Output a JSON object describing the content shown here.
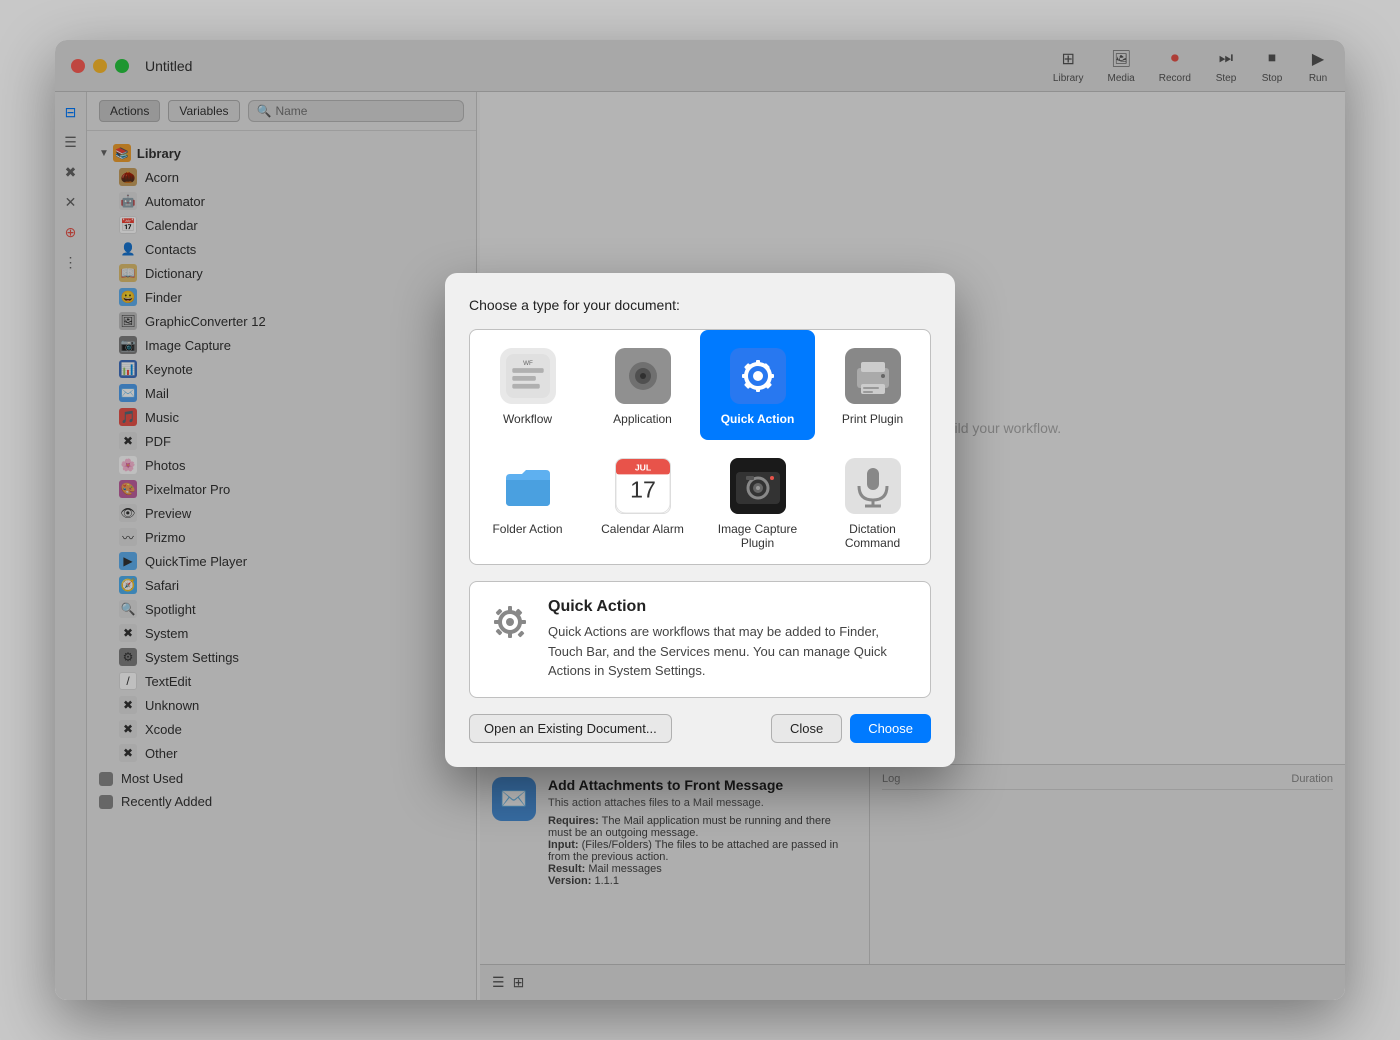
{
  "window": {
    "title": "Untitled",
    "toolbar": {
      "library_label": "Library",
      "media_label": "Media",
      "record_label": "Record",
      "step_label": "Step",
      "stop_label": "Stop",
      "run_label": "Run"
    }
  },
  "sidebar": {
    "tabs": {
      "actions": "Actions",
      "variables": "Variables"
    },
    "search_placeholder": "Name",
    "library_section": "Library",
    "items": [
      {
        "label": "Acorn",
        "icon": "🌰"
      },
      {
        "label": "Automator",
        "icon": "🤖"
      },
      {
        "label": "Calendar",
        "icon": "📅"
      },
      {
        "label": "Contacts",
        "icon": "👤"
      },
      {
        "label": "Dictionary",
        "icon": "📖"
      },
      {
        "label": "Finder",
        "icon": "😀"
      },
      {
        "label": "GraphicConverter 12",
        "icon": "🖼"
      },
      {
        "label": "Image Capture",
        "icon": "📷"
      },
      {
        "label": "Keynote",
        "icon": "📊"
      },
      {
        "label": "Mail",
        "icon": "✉️"
      },
      {
        "label": "Music",
        "icon": "🎵"
      },
      {
        "label": "PDF",
        "icon": "✖"
      },
      {
        "label": "Photos",
        "icon": "🌸"
      },
      {
        "label": "Pixelmator Pro",
        "icon": "🎨"
      },
      {
        "label": "Preview",
        "icon": "👁"
      },
      {
        "label": "Prizmo",
        "icon": "〰"
      },
      {
        "label": "QuickTime Player",
        "icon": "▶"
      },
      {
        "label": "Safari",
        "icon": "🧭"
      },
      {
        "label": "Spotlight",
        "icon": "🔍"
      },
      {
        "label": "System",
        "icon": "✖"
      },
      {
        "label": "System Settings",
        "icon": "⚙"
      },
      {
        "label": "TextEdit",
        "icon": "/"
      },
      {
        "label": "Unknown",
        "icon": "✖"
      },
      {
        "label": "Xcode",
        "icon": "✖"
      },
      {
        "label": "Other",
        "icon": "✖"
      }
    ],
    "categories": [
      {
        "label": "Most Used",
        "color": "#888888"
      },
      {
        "label": "Recently Added",
        "color": "#888888"
      }
    ]
  },
  "bottom_info": {
    "title": "Add Attachments to Front Message",
    "description": "This action attaches files to a Mail message.",
    "requires": "The Mail application must be running and there must be an outgoing message.",
    "input": "(Files/Folders) The files to be attached are passed in from the previous action.",
    "result": "Mail messages",
    "version": "1.1.1"
  },
  "log": {
    "label": "Log",
    "duration_label": "Duration"
  },
  "dialog": {
    "title": "Choose a type for your document:",
    "doc_types": [
      {
        "id": "workflow",
        "label": "Workflow"
      },
      {
        "id": "application",
        "label": "Application"
      },
      {
        "id": "quick_action",
        "label": "Quick Action",
        "selected": true
      },
      {
        "id": "print_plugin",
        "label": "Print Plugin"
      },
      {
        "id": "folder_action",
        "label": "Folder Action"
      },
      {
        "id": "calendar_alarm",
        "label": "Calendar Alarm"
      },
      {
        "id": "image_capture_plugin",
        "label": "Image Capture Plugin"
      },
      {
        "id": "dictation_command",
        "label": "Dictation Command"
      }
    ],
    "selected_title": "Quick Action",
    "selected_description": "Quick Actions are workflows that may be added to Finder, Touch Bar, and the Services menu. You can manage Quick Actions in System Settings.",
    "btn_open": "Open an Existing Document...",
    "btn_close": "Close",
    "btn_choose": "Choose"
  }
}
